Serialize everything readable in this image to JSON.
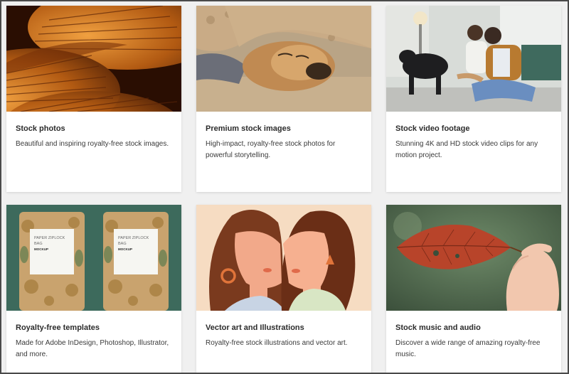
{
  "cards": [
    {
      "title": "Stock photos",
      "description": "Beautiful and inspiring royalty-free stock images.",
      "image": "mushroom-gills-photo"
    },
    {
      "title": "Premium stock images",
      "description": "High-impact, royalty-free stock photos for powerful storytelling.",
      "image": "sleeping-dog-photo"
    },
    {
      "title": "Stock video footage",
      "description": "Stunning 4K and HD stock video clips for any motion project.",
      "image": "family-with-dog-photo"
    },
    {
      "title": "Royalty-free templates",
      "description": "Made for Adobe InDesign, Photoshop, Illustrator, and more.",
      "image": "paper-ziplock-bag-mockup",
      "mockup_label_line1": "PAPER ZIPLOCK",
      "mockup_label_line2": "BAG",
      "mockup_label_line3": "MOCKUP"
    },
    {
      "title": "Vector art and Illustrations",
      "description": "Royalty-free stock illustrations and vector art.",
      "image": "two-women-illustration"
    },
    {
      "title": "Stock music and audio",
      "description": "Discover a wide range of amazing royalty-free music.",
      "image": "hand-holding-leaf-photo"
    }
  ]
}
